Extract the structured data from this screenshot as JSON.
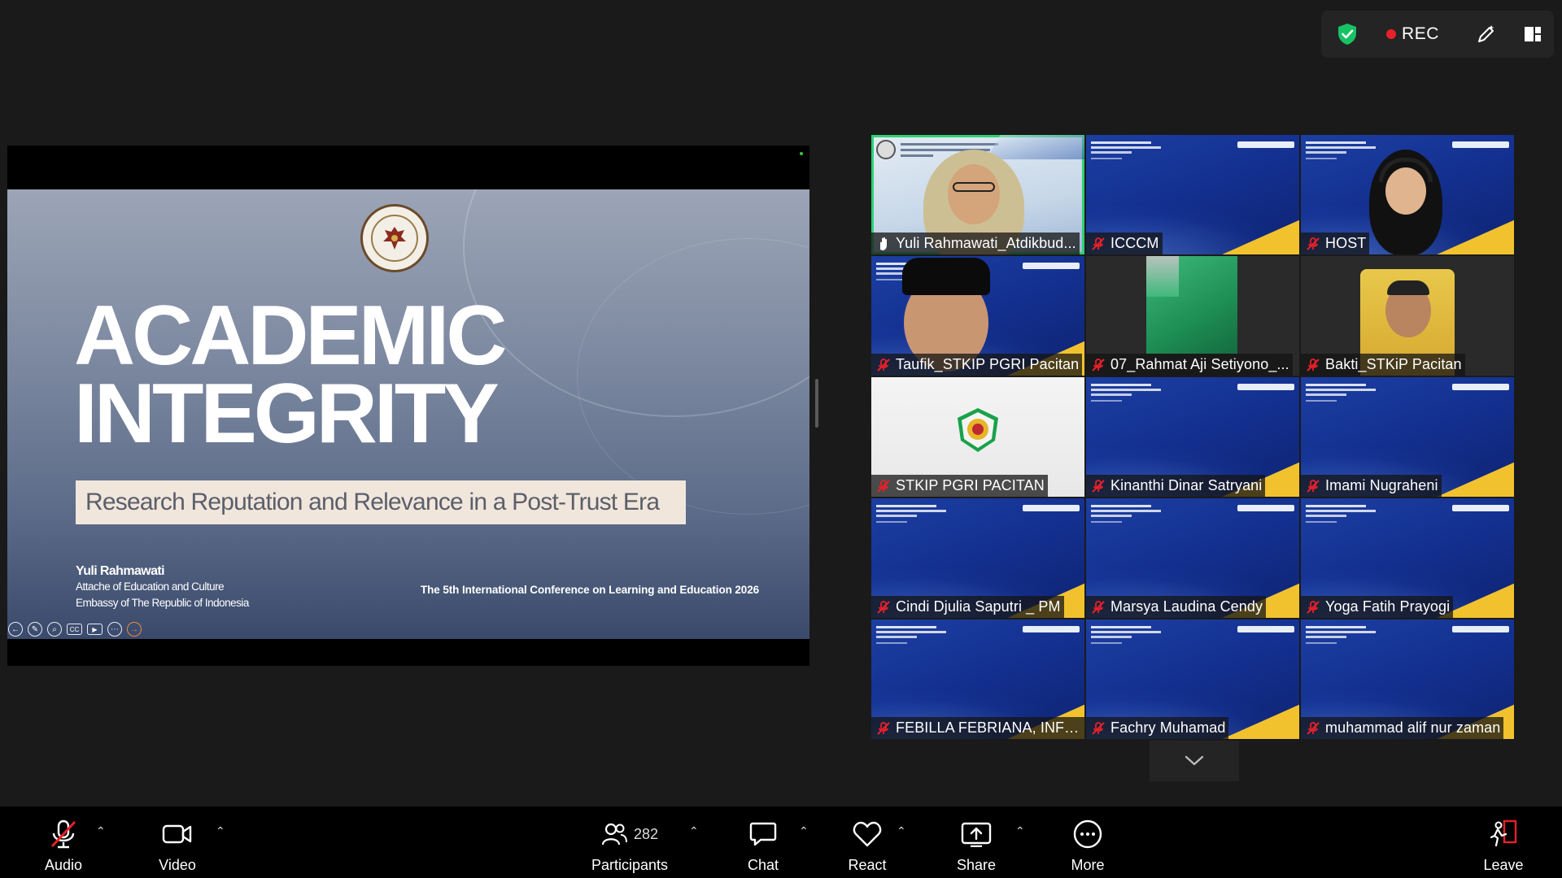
{
  "status_bar": {
    "rec_label": "REC",
    "rec_color": "#e8202a",
    "shield_color": "#17c264",
    "icons": [
      "shield-check-icon",
      "record-icon",
      "annotate-icon",
      "layout-icon"
    ]
  },
  "shared_slide": {
    "title_line1": "ACADEMIC",
    "title_line2": "INTEGRITY",
    "subtitle": "Research Reputation and Relevance in a Post-Trust Era",
    "presenter_name": "Yuli Rahmawati",
    "presenter_role": "Attache of Education and Culture",
    "presenter_org": "Embassy of The Republic of Indonesia",
    "conference": "The 5th International Conference on Learning and Education 2026",
    "controls": [
      "back-icon",
      "pen-icon",
      "zoom-icon",
      "captions-icon",
      "video-icon",
      "more-icon",
      "next-icon"
    ]
  },
  "gallery": {
    "tiles": [
      {
        "name": "Yuli Rahmawati_Atdikbud...",
        "muted": false,
        "active": true
      },
      {
        "name": "ICCCM",
        "muted": true
      },
      {
        "name": "HOST",
        "muted": true
      },
      {
        "name": "Taufik_STKIP PGRI Pacitan",
        "muted": true
      },
      {
        "name": "07_Rahmat Aji Setiyono_...",
        "muted": true
      },
      {
        "name": "Bakti_STKiP Pacitan",
        "muted": true
      },
      {
        "name": "STKIP PGRI PACITAN",
        "muted": true
      },
      {
        "name": "Kinanthi Dinar Satryani",
        "muted": true
      },
      {
        "name": "Imami Nugraheni",
        "muted": true
      },
      {
        "name": "Cindi Djulia Saputri _ PM",
        "muted": true
      },
      {
        "name": "Marsya Laudina Cendy",
        "muted": true
      },
      {
        "name": "Yoga Fatih Prayogi",
        "muted": true
      },
      {
        "name": "FEBILLA FEBRIANA, INFO...",
        "muted": true
      },
      {
        "name": "Fachry Muhamad",
        "muted": true
      },
      {
        "name": "muhammad alif nur zaman",
        "muted": true
      }
    ],
    "active_speaker_color": "#2ed173"
  },
  "toolbar": {
    "audio_label": "Audio",
    "video_label": "Video",
    "participants_label": "Participants",
    "participants_count": "282",
    "chat_label": "Chat",
    "react_label": "React",
    "share_label": "Share",
    "more_label": "More",
    "leave_label": "Leave",
    "leave_color": "#e8202a"
  }
}
